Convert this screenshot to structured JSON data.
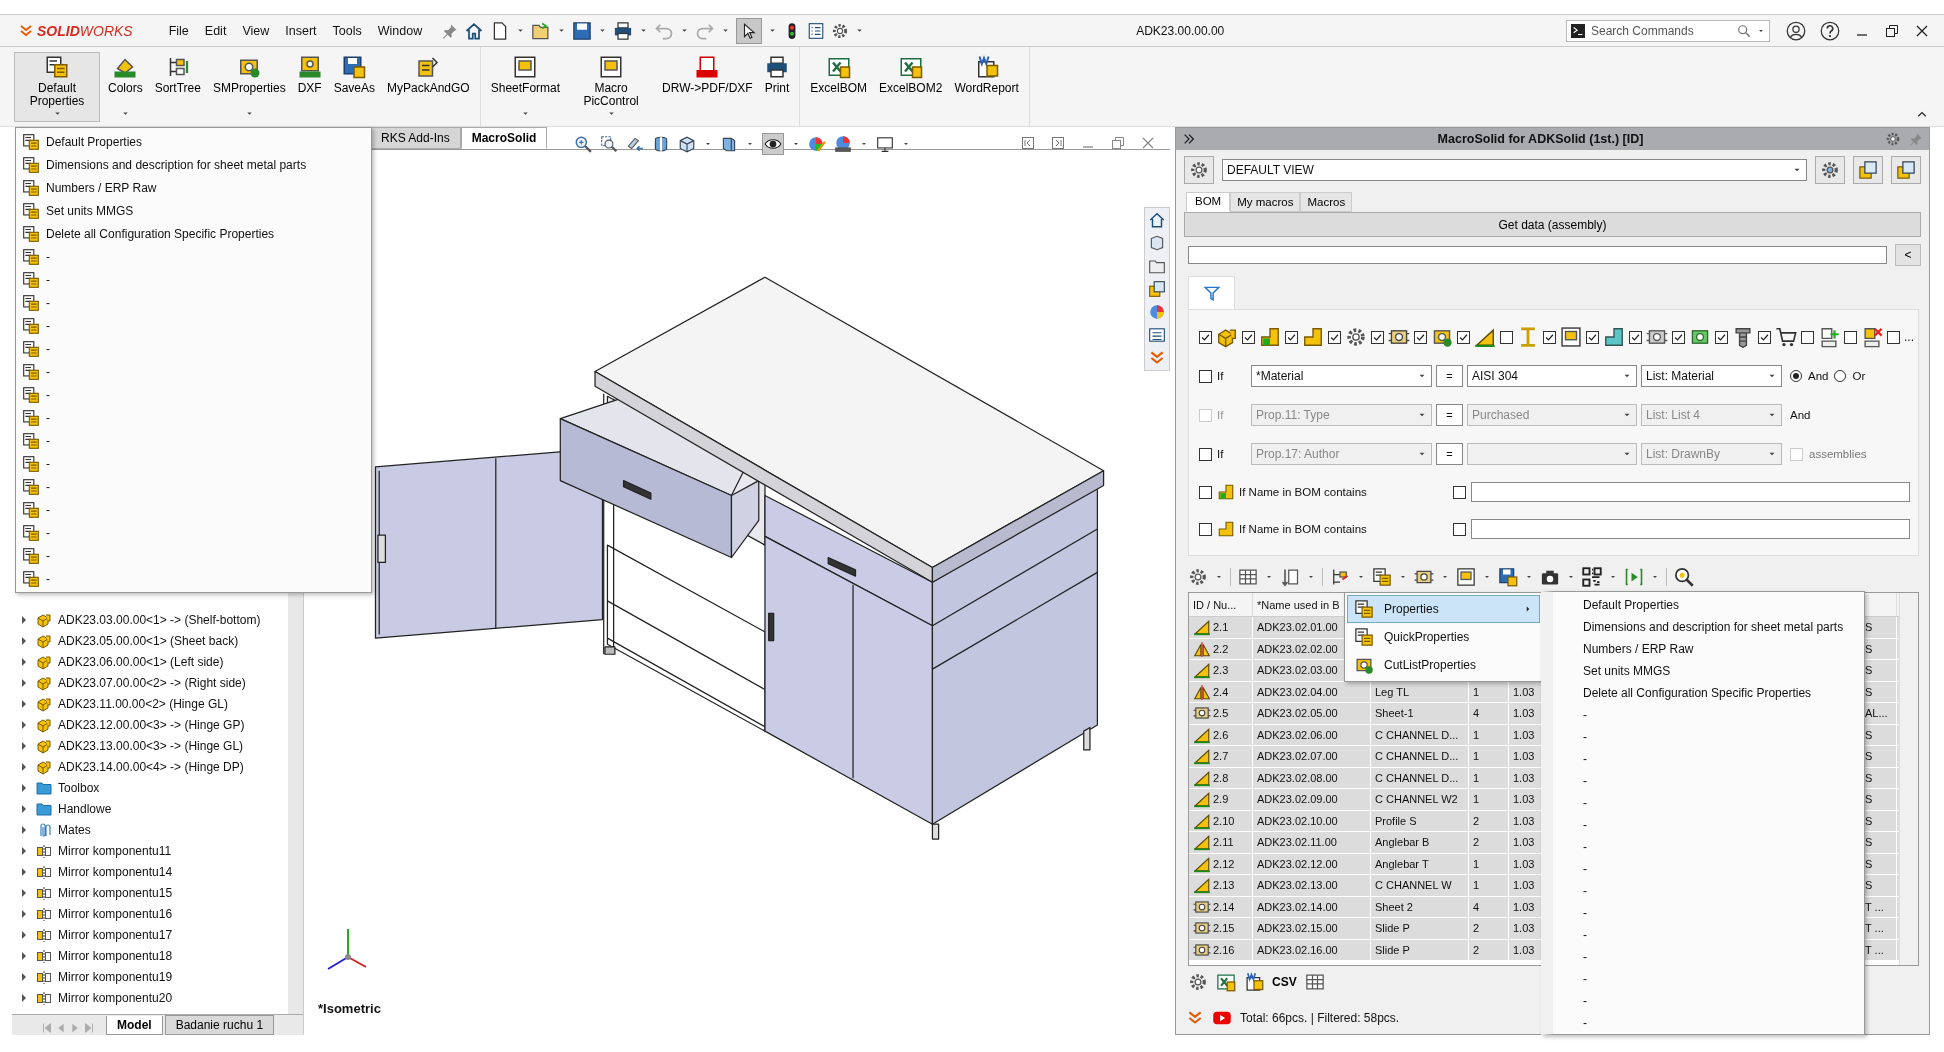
{
  "title_bar": {
    "logo": {
      "bold": "SOLID",
      "light": "WORKS"
    },
    "menus": [
      "File",
      "Edit",
      "View",
      "Insert",
      "Tools",
      "Window"
    ],
    "document_title": "ADK23.00.00.00",
    "search": {
      "placeholder": "Search Commands"
    }
  },
  "ribbon": {
    "groups": [
      {
        "buttons": [
          {
            "label": "Default Properties",
            "selected": true,
            "dropdown": true
          },
          {
            "label": "Colors",
            "selected": false,
            "dropdown": true
          },
          {
            "label": "SortTree",
            "selected": false,
            "dropdown": false
          },
          {
            "label": "SMProperties",
            "selected": false,
            "dropdown": true
          },
          {
            "label": "DXF",
            "selected": false,
            "dropdown": false
          },
          {
            "label": "SaveAs",
            "selected": false,
            "dropdown": false
          },
          {
            "label": "MyPackAndGO",
            "selected": false,
            "dropdown": false
          }
        ]
      },
      {
        "buttons": [
          {
            "label": "SheetFormat",
            "selected": false,
            "dropdown": true
          },
          {
            "label": "Macro PicControl",
            "selected": false,
            "dropdown": true
          },
          {
            "label": "DRW->PDF/DXF",
            "selected": false,
            "dropdown": false
          },
          {
            "label": "Print",
            "selected": false,
            "dropdown": false
          }
        ]
      },
      {
        "buttons": [
          {
            "label": "ExcelBOM",
            "selected": false,
            "dropdown": false
          },
          {
            "label": "ExcelBOM2",
            "selected": false,
            "dropdown": false
          },
          {
            "label": "WordReport",
            "selected": false,
            "dropdown": false
          }
        ]
      }
    ]
  },
  "default_properties_menu": [
    "Default Properties",
    "Dimensions and description for sheet metal parts",
    "Numbers / ERP Raw",
    "Set units MMGS",
    "Delete all Configuration Specific Properties",
    "-",
    "-",
    "-",
    "-",
    "-",
    "-",
    "-",
    "-",
    "-",
    "-",
    "-",
    "-",
    "-",
    "-",
    "-"
  ],
  "feature_tree": {
    "items": [
      {
        "label": "ADK23.03.00.00<1> -> (Shelf-bottom)",
        "kind": "assembly"
      },
      {
        "label": "ADK23.05.00.00<1> (Sheet back)",
        "kind": "assembly"
      },
      {
        "label": "ADK23.06.00.00<1> (Left side)",
        "kind": "assembly"
      },
      {
        "label": "ADK23.07.00.00<2> -> (Right side)",
        "kind": "assembly"
      },
      {
        "label": "ADK23.11.00.00<2> (Hinge GL)",
        "kind": "assembly"
      },
      {
        "label": "ADK23.12.00.00<3> -> (Hinge GP)",
        "kind": "assembly"
      },
      {
        "label": "ADK23.13.00.00<3> -> (Hinge GL)",
        "kind": "assembly"
      },
      {
        "label": "ADK23.14.00.00<4> -> (Hinge DP)",
        "kind": "assembly"
      },
      {
        "label": "Toolbox",
        "kind": "folder"
      },
      {
        "label": "Handlowe",
        "kind": "folder"
      },
      {
        "label": "Mates",
        "kind": "mates"
      },
      {
        "label": "Mirror komponentu11",
        "kind": "mirror"
      },
      {
        "label": "Mirror komponentu14",
        "kind": "mirror"
      },
      {
        "label": "Mirror komponentu15",
        "kind": "mirror"
      },
      {
        "label": "Mirror komponentu16",
        "kind": "mirror"
      },
      {
        "label": "Mirror komponentu17",
        "kind": "mirror"
      },
      {
        "label": "Mirror komponentu18",
        "kind": "mirror"
      },
      {
        "label": "Mirror komponentu19",
        "kind": "mirror"
      },
      {
        "label": "Mirror komponentu20",
        "kind": "mirror"
      }
    ],
    "bottom_tabs": [
      {
        "label": "Model",
        "selected": true
      },
      {
        "label": "Badanie ruchu 1",
        "selected": false
      }
    ]
  },
  "viewport": {
    "command_tabs": [
      {
        "label": "RKS Add-Ins",
        "selected": false
      },
      {
        "label": "MacroSolid",
        "selected": true
      }
    ],
    "view_name": "*Isometric"
  },
  "task_pane": {
    "title": "MacroSolid for ADKSolid (1st.) [ID]",
    "view_select": "DEFAULT VIEW",
    "tabs": [
      {
        "label": "BOM",
        "selected": true
      },
      {
        "label": "My macros",
        "selected": false
      },
      {
        "label": "Macros",
        "selected": false
      }
    ],
    "get_data_button": "Get data (assembly)",
    "back_button": "<",
    "type_filters": [
      {
        "checked": true
      },
      {
        "checked": true
      },
      {
        "checked": true
      },
      {
        "checked": true
      },
      {
        "checked": true
      },
      {
        "checked": true
      },
      {
        "checked": true
      },
      {
        "checked": false
      },
      {
        "checked": true
      },
      {
        "checked": true
      },
      {
        "checked": true
      },
      {
        "checked": true
      },
      {
        "checked": true
      },
      {
        "checked": true
      },
      {
        "checked": false
      },
      {
        "checked": false
      },
      {
        "checked": false
      }
    ],
    "type_filters_more": "...",
    "conditions": [
      {
        "checked": false,
        "checkbox_disabled": false,
        "fields_disabled": false,
        "label": "If",
        "property": "*Material",
        "operator": "=",
        "value": "AISI 304",
        "list": "List: Material",
        "extra": {
          "kind": "radio",
          "options": [
            {
              "label": "And",
              "selected": true
            },
            {
              "label": "Or",
              "selected": false
            }
          ]
        }
      },
      {
        "checked": false,
        "checkbox_disabled": true,
        "fields_disabled": true,
        "label": "If",
        "property": "Prop.11: Type",
        "operator": "=",
        "value": "Purchased",
        "list": "List: List 4",
        "extra": {
          "kind": "text",
          "label": "And"
        }
      },
      {
        "checked": false,
        "checkbox_disabled": false,
        "fields_disabled": true,
        "label": "If",
        "property": "Prop.17: Author",
        "operator": "=",
        "list": "List: DrawnBy",
        "extra": {
          "kind": "checkbox",
          "label": "assemblies",
          "checked": false,
          "disabled": true
        }
      }
    ],
    "name_filters": [
      {
        "checked": false,
        "label": "If Name in BOM contains",
        "option_checked": false,
        "kind": "green"
      },
      {
        "checked": false,
        "label": "If Name in BOM contains",
        "option_checked": false,
        "kind": "yellow"
      }
    ],
    "table": {
      "columns": [
        "ID / Nu...",
        "*Name used in B"
      ],
      "rows": [
        {
          "kind": "profile",
          "id": "2.1",
          "name": "ADK23.02.01.00",
          "column_6": "S"
        },
        {
          "kind": "profile-pair",
          "id": "2.2",
          "name": "ADK23.02.02.00",
          "column_6": "S"
        },
        {
          "kind": "profile",
          "id": "2.3",
          "name": "ADK23.02.03.00",
          "column_6": "S"
        },
        {
          "kind": "profile-pair",
          "id": "2.4",
          "name": "ADK23.02.04.00",
          "column_3": "Leg TL",
          "column_4": "1",
          "column_5": "1.03",
          "column_6": "S"
        },
        {
          "kind": "sheet-part",
          "id": "2.5",
          "name": "ADK23.02.05.00",
          "column_3": "Sheet-1",
          "column_4": "4",
          "column_5": "1.03",
          "column_6": "AL..."
        },
        {
          "kind": "profile",
          "id": "2.6",
          "name": "ADK23.02.06.00",
          "column_3": "C CHANNEL D...",
          "column_4": "1",
          "column_5": "1.03",
          "column_6": "S"
        },
        {
          "kind": "profile",
          "id": "2.7",
          "name": "ADK23.02.07.00",
          "column_3": "C CHANNEL D...",
          "column_4": "1",
          "column_5": "1.03",
          "column_6": "S"
        },
        {
          "kind": "profile",
          "id": "2.8",
          "name": "ADK23.02.08.00",
          "column_3": "C CHANNEL D...",
          "column_4": "1",
          "column_5": "1.03",
          "column_6": "S"
        },
        {
          "kind": "profile",
          "id": "2.9",
          "name": "ADK23.02.09.00",
          "column_3": "C CHANNEL W2",
          "column_4": "1",
          "column_5": "1.03",
          "column_6": "S"
        },
        {
          "kind": "profile",
          "id": "2.10",
          "name": "ADK23.02.10.00",
          "column_3": "Profile S",
          "column_4": "2",
          "column_5": "1.03",
          "column_6": "S"
        },
        {
          "kind": "profile",
          "id": "2.11",
          "name": "ADK23.02.11.00",
          "column_3": "Anglebar B",
          "column_4": "2",
          "column_5": "1.03",
          "column_6": "S"
        },
        {
          "kind": "profile",
          "id": "2.12",
          "name": "ADK23.02.12.00",
          "column_3": "Anglebar T",
          "column_4": "1",
          "column_5": "1.03",
          "column_6": "S"
        },
        {
          "kind": "profile",
          "id": "2.13",
          "name": "ADK23.02.13.00",
          "column_3": "C CHANNEL W",
          "column_4": "1",
          "column_5": "1.03",
          "column_6": "S"
        },
        {
          "kind": "sheet-part",
          "id": "2.14",
          "name": "ADK23.02.14.00",
          "column_3": "Sheet 2",
          "column_4": "4",
          "column_5": "1.03",
          "column_6": "T ..."
        },
        {
          "kind": "sheet-part",
          "id": "2.15",
          "name": "ADK23.02.15.00",
          "column_3": "Slide P",
          "column_4": "2",
          "column_5": "1.03",
          "column_6": "T ..."
        },
        {
          "kind": "sheet-part",
          "id": "2.16",
          "name": "ADK23.02.16.00",
          "column_3": "Slide P",
          "column_4": "2",
          "column_5": "1.03",
          "column_6": "T ..."
        }
      ]
    },
    "context_menu": [
      {
        "label": "Properties",
        "selected": true,
        "submenu": true
      },
      {
        "label": "QuickProperties",
        "selected": false,
        "submenu": false
      },
      {
        "label": "CutListProperties",
        "selected": false,
        "submenu": false
      }
    ],
    "submenu": [
      "Default Properties",
      "Dimensions and description for sheet metal parts",
      "Numbers / ERP Raw",
      "Set units MMGS",
      "Delete all Configuration Specific Properties",
      "-",
      "-",
      "-",
      "-",
      "-",
      "-",
      "-",
      "-",
      "-",
      "-",
      "-",
      "-",
      "-",
      "-",
      "-"
    ],
    "csv_button": "CSV",
    "status": "Total: 66pcs. | Filtered: 58pcs."
  }
}
